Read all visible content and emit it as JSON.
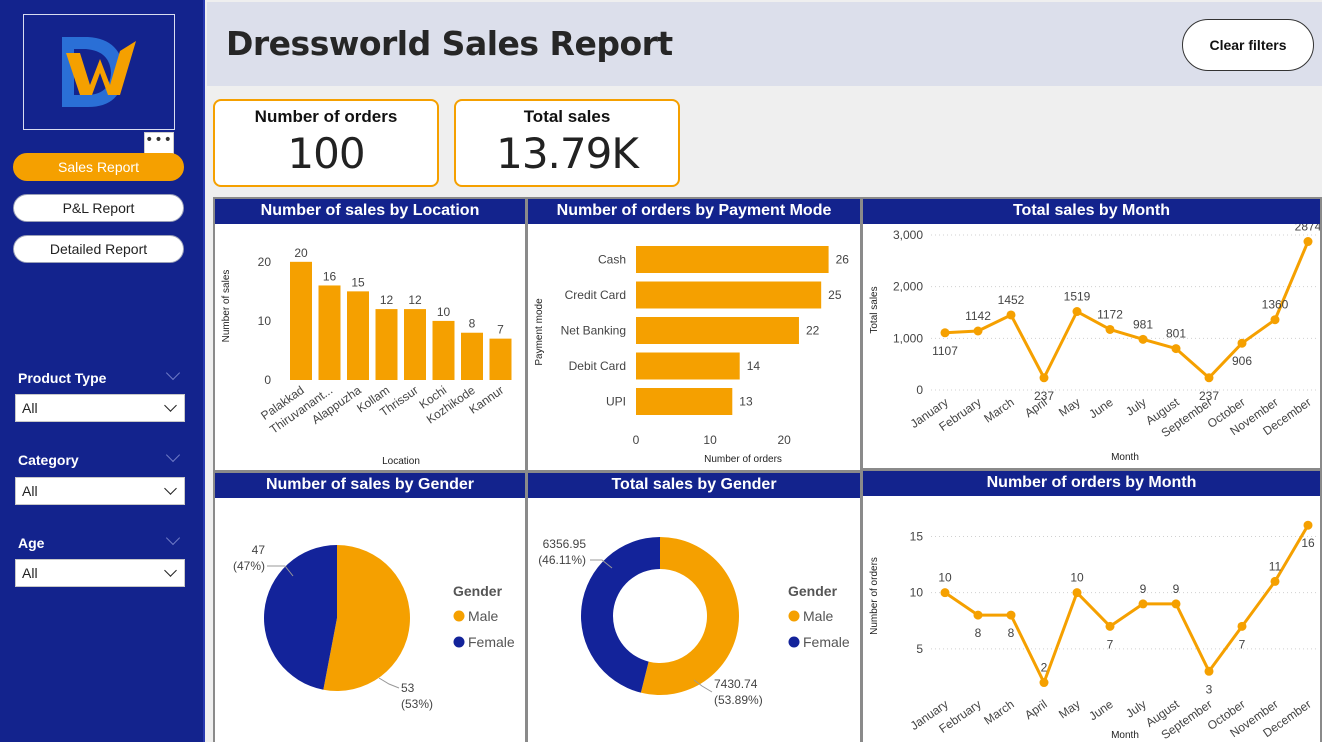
{
  "title": "Dressworld Sales Report",
  "clear_filters": "Clear filters",
  "nav": {
    "more": "•••",
    "items": [
      {
        "label": "Sales Report"
      },
      {
        "label": "P&L Report"
      },
      {
        "label": "Detailed Report"
      }
    ]
  },
  "slicers": [
    {
      "title": "Product Type",
      "value": "All"
    },
    {
      "title": "Category",
      "value": "All"
    },
    {
      "title": "Age",
      "value": "All"
    }
  ],
  "kpis": {
    "orders": {
      "label": "Number of orders",
      "value": "100"
    },
    "sales": {
      "label": "Total sales",
      "value": "13.79K"
    }
  },
  "colors": {
    "accent": "#f5a000",
    "navy": "#13238d",
    "female": "#13239a"
  },
  "chart_data": [
    {
      "id": "location",
      "type": "bar",
      "title": "Number of sales by Location",
      "xlabel": "Location",
      "ylabel": "Number of sales",
      "categories": [
        "Palakkad",
        "Thiruvanant...",
        "Alappuzha",
        "Kollam",
        "Thrissur",
        "Kochi",
        "Kozhikode",
        "Kannur"
      ],
      "values": [
        20,
        16,
        15,
        12,
        12,
        10,
        8,
        7
      ],
      "yticks": [
        "0",
        "10",
        "20"
      ],
      "ylim": [
        0,
        22
      ]
    },
    {
      "id": "payment",
      "type": "bar",
      "orientation": "horizontal",
      "title": "Number of orders by Payment Mode",
      "xlabel": "Number of orders",
      "ylabel": "Payment mode",
      "categories": [
        "Cash",
        "Credit Card",
        "Net Banking",
        "Debit Card",
        "UPI"
      ],
      "values": [
        26,
        25,
        22,
        14,
        13
      ],
      "xticks": [
        "0",
        "10",
        "20"
      ],
      "xlim": [
        0,
        27
      ]
    },
    {
      "id": "sales_month",
      "type": "line",
      "title": "Total sales by Month",
      "xlabel": "Month",
      "ylabel": "Total sales",
      "categories": [
        "January",
        "February",
        "March",
        "April",
        "May",
        "June",
        "July",
        "August",
        "September",
        "October",
        "November",
        "December"
      ],
      "values": [
        1107,
        1142,
        1452,
        237,
        1519,
        1172,
        981,
        801,
        237,
        906,
        1360,
        2874
      ],
      "yticks": [
        "0",
        "1,000",
        "2,000",
        "3,000"
      ],
      "ylim": [
        0,
        3000
      ]
    },
    {
      "id": "gender_count",
      "type": "pie",
      "title": "Number of sales by Gender",
      "legend_title": "Gender",
      "slices": [
        {
          "name": "Male",
          "value": 53,
          "label": "53",
          "pct": "(53%)"
        },
        {
          "name": "Female",
          "value": 47,
          "label": "47",
          "pct": "(47%)"
        }
      ]
    },
    {
      "id": "gender_sales",
      "type": "pie",
      "variant": "donut",
      "title": "Total sales by Gender",
      "legend_title": "Gender",
      "slices": [
        {
          "name": "Male",
          "value": 7430.74,
          "label": "7430.74",
          "pct": "(53.89%)"
        },
        {
          "name": "Female",
          "value": 6356.95,
          "label": "6356.95",
          "pct": "(46.11%)"
        }
      ]
    },
    {
      "id": "orders_month",
      "type": "line",
      "title": "Number of orders by Month",
      "xlabel": "Month",
      "ylabel": "Number of orders",
      "categories": [
        "January",
        "February",
        "March",
        "April",
        "May",
        "June",
        "July",
        "August",
        "September",
        "October",
        "November",
        "December"
      ],
      "values": [
        10,
        8,
        8,
        2,
        10,
        7,
        9,
        9,
        3,
        7,
        11,
        16
      ],
      "yticks": [
        "5",
        "10",
        "15"
      ],
      "ylim": [
        0,
        17
      ]
    }
  ]
}
